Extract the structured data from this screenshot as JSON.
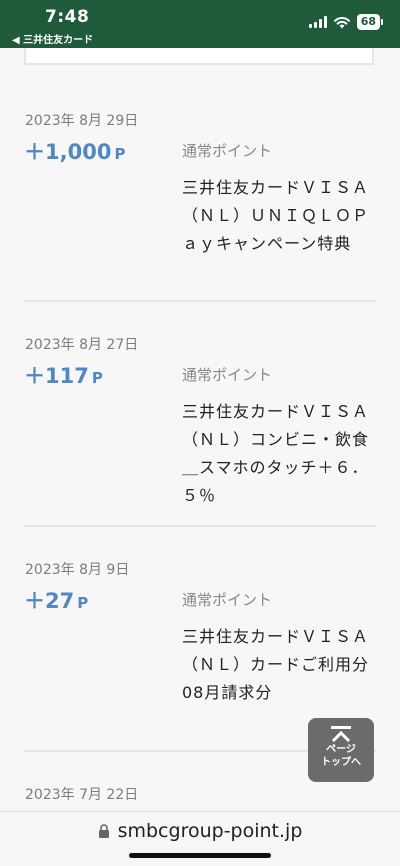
{
  "status_bar": {
    "time": "7:48",
    "back_app": "◀ 三井住友カード",
    "battery": "68"
  },
  "entries": [
    {
      "date": "2023年 8月 29日",
      "points": "＋1,000",
      "unit": "P",
      "type": "通常ポイント",
      "description": "三井住友カードＶＩＳＡ（ＮＬ）ＵＮＩＱＬＯＰａｙキャンペーン特典"
    },
    {
      "date": "2023年 8月 27日",
      "points": "＋117",
      "unit": "P",
      "type": "通常ポイント",
      "description": "三井住友カードＶＩＳＡ（ＮＬ）コンビニ・飲食＿スマホのタッチ＋６．５％"
    },
    {
      "date": "2023年 8月 9日",
      "points": "＋27",
      "unit": "P",
      "type": "通常ポイント",
      "description": "三井住友カードＶＩＳＡ（ＮＬ）カードご利用分　08月請求分"
    },
    {
      "date": "2023年 7月 22日"
    }
  ],
  "page_top": {
    "line1": "ページ",
    "line2": "トップへ"
  },
  "url_bar": {
    "url": "smbcgroup-point.jp"
  },
  "colors": {
    "header": "#1f5a3a",
    "points": "#4f88c5"
  }
}
